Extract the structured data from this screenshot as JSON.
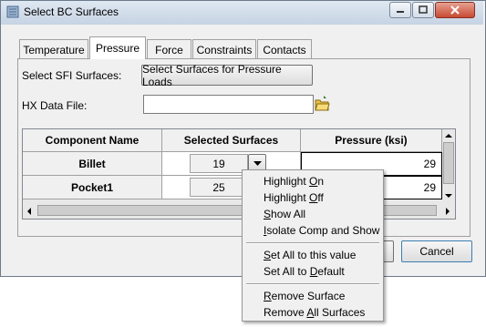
{
  "window": {
    "title": "Select BC Surfaces"
  },
  "tabs": [
    {
      "label": "Temperature",
      "active": false
    },
    {
      "label": "Pressure",
      "active": true
    },
    {
      "label": "Force",
      "active": false
    },
    {
      "label": "Constraints",
      "active": false
    },
    {
      "label": "Contacts",
      "active": false
    }
  ],
  "pressure": {
    "sfi_label": "Select SFI Surfaces:",
    "sfi_button": "Select Surfaces for Pressure Loads",
    "hx_label": "HX Data File:",
    "hx_value": ""
  },
  "table": {
    "headers": [
      "Component Name",
      "Selected Surfaces",
      "Pressure (ksi)"
    ],
    "rows": [
      {
        "component": "Billet",
        "surfaces": "19",
        "pressure": "29"
      },
      {
        "component": "Pocket1",
        "surfaces": "25",
        "pressure": "29"
      }
    ]
  },
  "cancel_button": "Cancel",
  "context_menu": {
    "items": [
      {
        "pre": "Highlight ",
        "ul": "O",
        "post": "n"
      },
      {
        "pre": "Highlight ",
        "ul": "O",
        "post": "ff"
      },
      {
        "pre": "",
        "ul": "S",
        "post": "how All"
      },
      {
        "pre": "",
        "ul": "I",
        "post": "solate Comp and Show"
      },
      {
        "pre": "",
        "ul": "S",
        "post": "et All to this value"
      },
      {
        "pre": "Set All to ",
        "ul": "D",
        "post": "efault"
      },
      {
        "pre": "",
        "ul": "R",
        "post": "emove Surface"
      },
      {
        "pre": "Remove ",
        "ul": "A",
        "post": "ll Surfaces"
      }
    ]
  },
  "colors": {
    "accent_dropdown": "#3399ff",
    "window_bg": "#f0f0f0"
  },
  "icons": [
    "app-icon",
    "minimize-icon",
    "maximize-icon",
    "close-icon",
    "folder-open-icon",
    "chevron-down-icon",
    "scroll-up-icon",
    "scroll-down-icon",
    "scroll-left-icon",
    "scroll-right-icon"
  ]
}
